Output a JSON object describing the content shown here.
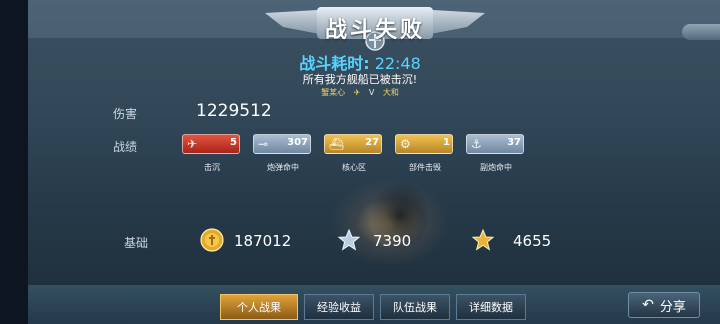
{
  "header": {
    "title": "战斗失败",
    "duration_label": "战斗耗时:",
    "duration_value": "22:48",
    "result_message": "所有我方舰船已被击沉!",
    "player_name": "蟹某心",
    "vs_text": "V",
    "enemy_name": "大和"
  },
  "stats": {
    "damage_label": "伤害",
    "damage_value": "1229512",
    "record_label": "战绩",
    "badges": [
      {
        "name": "击沉",
        "count": "5",
        "icon": "sink-icon",
        "color": "#c93527"
      },
      {
        "name": "炮弹命中",
        "count": "307",
        "icon": "shell-hit-icon",
        "color": "#8aa2ba"
      },
      {
        "name": "核心区",
        "count": "27",
        "icon": "core-zone-icon",
        "color": "#d9a53b"
      },
      {
        "name": "部件击毁",
        "count": "1",
        "icon": "part-destroy-icon",
        "color": "#d9a53b"
      },
      {
        "name": "副炮命中",
        "count": "37",
        "icon": "secondary-gun-icon",
        "color": "#8aa2ba"
      }
    ]
  },
  "base": {
    "label": "基础",
    "gold": "187012",
    "silver_star": "7390",
    "gold_star": "4655"
  },
  "tabs": [
    {
      "label": "个人战果",
      "active": true
    },
    {
      "label": "经验收益",
      "active": false
    },
    {
      "label": "队伍战果",
      "active": false
    },
    {
      "label": "详细数据",
      "active": false
    }
  ],
  "share_label": "分享"
}
